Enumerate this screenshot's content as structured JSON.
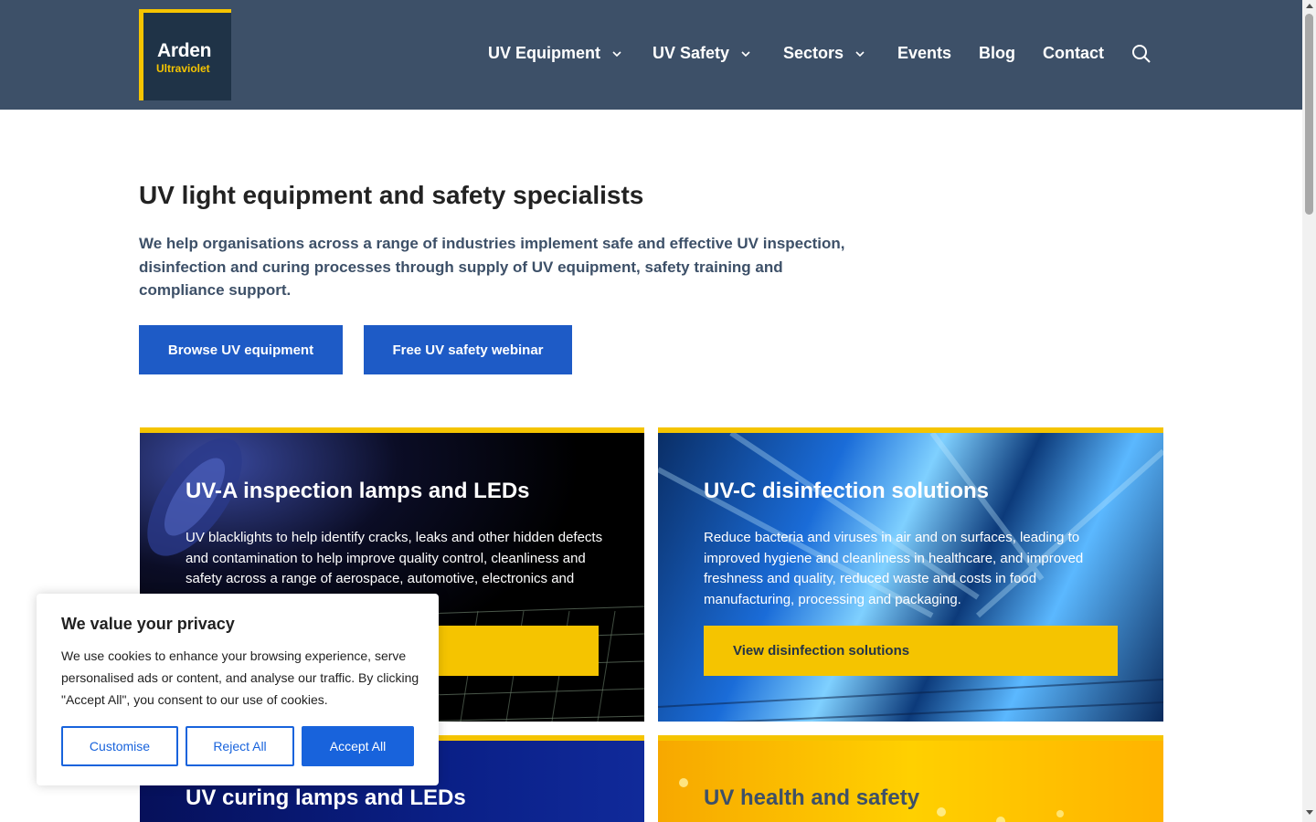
{
  "logo": {
    "main": "Arden",
    "sub": "Ultraviolet"
  },
  "nav": {
    "items": [
      {
        "label": "UV Equipment",
        "has_dropdown": true
      },
      {
        "label": "UV Safety",
        "has_dropdown": true
      },
      {
        "label": "Sectors",
        "has_dropdown": true
      },
      {
        "label": "Events",
        "has_dropdown": false
      },
      {
        "label": "Blog",
        "has_dropdown": false
      },
      {
        "label": "Contact",
        "has_dropdown": false
      }
    ],
    "search_icon": "search-icon"
  },
  "hero": {
    "title": "UV light equipment and safety specialists",
    "text": "We help organisations across a range of industries implement safe and effective UV inspection, disinfection and curing processes through supply of UV equipment, safety training and compliance support.",
    "buttons": [
      "Browse UV equipment",
      "Free UV safety webinar"
    ]
  },
  "cards": [
    {
      "title": "UV-A inspection lamps and LEDs",
      "text": "UV blacklights to help identify cracks, leaks and other hidden defects and contamination to help improve quality control, cleanliness and safety across a range of aerospace, automotive, electronics and security processes.",
      "button": ""
    },
    {
      "title": "UV-C disinfection solutions",
      "text": "Reduce bacteria and viruses in air and on surfaces, leading to improved hygiene and cleanliness in healthcare, and improved freshness and quality, reduced waste and costs in food manufacturing, processing and packaging.",
      "button": "View disinfection solutions"
    },
    {
      "title": "UV curing lamps and LEDs"
    },
    {
      "title": "UV health and safety"
    }
  ],
  "cookie": {
    "title": "We value your privacy",
    "text": "We use cookies to enhance your browsing experience, serve personalised ads or content, and analyse our traffic. By clicking \"Accept All\", you consent to our use of cookies.",
    "buttons": {
      "customise": "Customise",
      "reject": "Reject All",
      "accept": "Accept All"
    }
  },
  "colors": {
    "header_bg": "#3d5068",
    "accent_yellow": "#f5c400",
    "primary_blue": "#1e5bc6",
    "cookie_blue": "#1863dc"
  }
}
